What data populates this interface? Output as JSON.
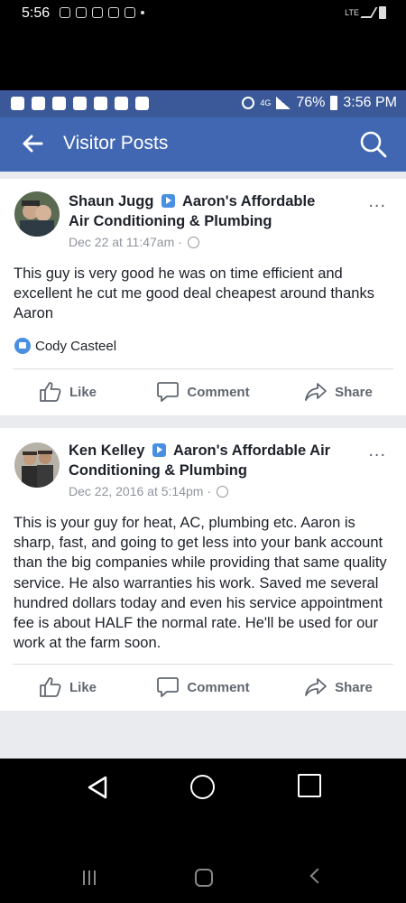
{
  "outer_status": {
    "time": "5:56",
    "network": "LTE"
  },
  "inner_status": {
    "battery": "76%",
    "time": "3:56 PM",
    "network": "4G"
  },
  "appbar": {
    "title": "Visitor Posts"
  },
  "posts": [
    {
      "author": "Shaun Jugg",
      "page": "Aaron's Affordable Air Conditioning & Plumbing",
      "page_line1": "Aaron's Affordable",
      "page_line2": "Air Conditioning & Plumbing",
      "date": "Dec 22 at 11:47am",
      "text": "This guy is very good he was on time efficient and excellent he cut me good deal cheapest around thanks Aaron",
      "reactor": "Cody Casteel",
      "actions": {
        "like": "Like",
        "comment": "Comment",
        "share": "Share"
      }
    },
    {
      "author": "Ken Kelley",
      "page": "Aaron's Affordable Air Conditioning & Plumbing",
      "page_line1": "Aaron's Affordable Air",
      "page_line2": "Conditioning & Plumbing",
      "date": "Dec 22, 2016 at 5:14pm",
      "text": "This is your guy for heat, AC, plumbing etc. Aaron is sharp, fast, and going to get less into your bank account than the big companies while providing that same quality service. He also warranties his work. Saved me several hundred dollars today and even his service appointment fee is about HALF  the normal rate. He'll be used for our work at the farm soon.",
      "actions": {
        "like": "Like",
        "comment": "Comment",
        "share": "Share"
      }
    }
  ],
  "colors": {
    "brand": "#4267b2",
    "status_bar": "#3b5998",
    "feed_bg": "#e9ebee",
    "like_blue": "#4a90e2"
  }
}
